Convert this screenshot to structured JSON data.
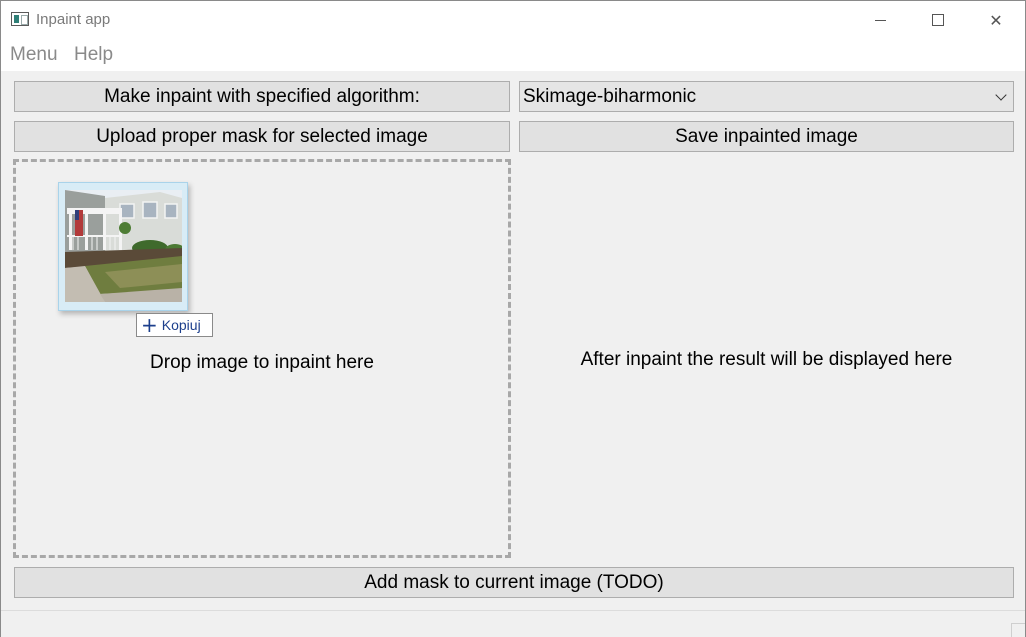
{
  "window": {
    "title": "Inpaint app",
    "icon": "app-window-icon",
    "controls": {
      "minimize_icon": "minimize-icon",
      "maximize_glyph": "☐",
      "close_glyph": "✕"
    }
  },
  "menubar": {
    "items": [
      {
        "label": "Menu"
      },
      {
        "label": "Help"
      }
    ]
  },
  "toolbar": {
    "algorithm_button_label": "Make inpaint with specified algorithm:",
    "algorithm_select": {
      "selected": "Skimage-biharmonic"
    },
    "upload_mask_label": "Upload proper mask for selected image",
    "save_label": "Save inpainted image"
  },
  "dropzone": {
    "text": "Drop image to inpaint here",
    "drag_preview": {
      "icon": "house-photo-thumbnail",
      "badge_icon": "plus-icon",
      "badge_label": "Kopiuj"
    }
  },
  "result": {
    "text": "After inpaint the result will be displayed here"
  },
  "footer": {
    "add_mask_label": "Add mask to current image (TODO)"
  },
  "colors": {
    "window_bg": "#f0f0f0",
    "button_bg": "#e1e1e1",
    "button_border": "#adadad",
    "dashed_border": "#a8a8a8",
    "badge_text": "#1c3f8c"
  }
}
